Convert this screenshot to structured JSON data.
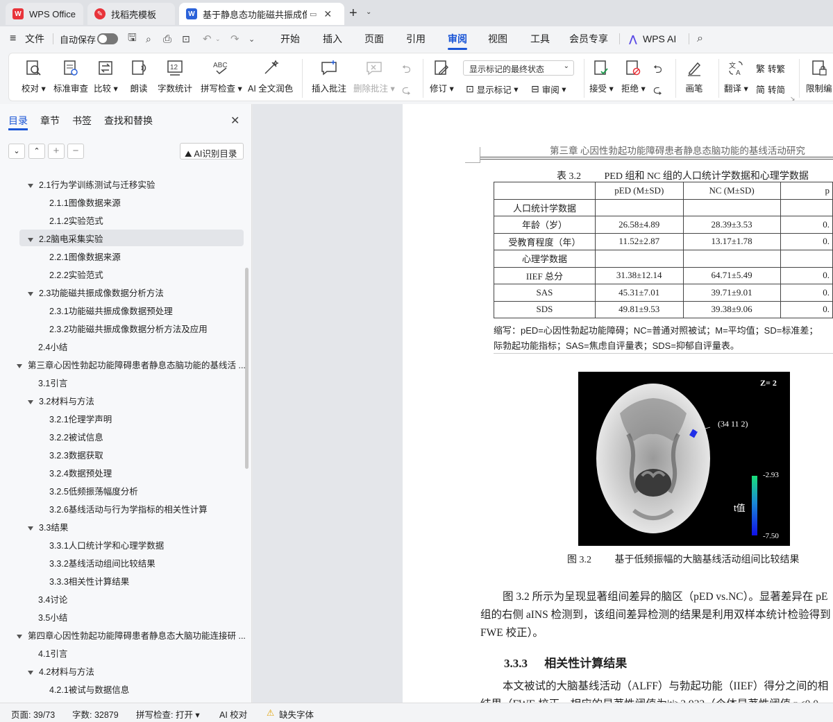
{
  "tabs": [
    {
      "label": "WPS Office"
    },
    {
      "label": "找稻壳模板"
    },
    {
      "label": "基于静息态功能磁共振成像的"
    }
  ],
  "menu": {
    "file": "文件",
    "autosave": "自动保存",
    "items": [
      "开始",
      "插入",
      "页面",
      "引用",
      "审阅",
      "视图",
      "工具",
      "会员专享"
    ],
    "active": "审阅",
    "wps_ai": "WPS AI"
  },
  "ribbon": {
    "proofread": "校对",
    "std_review": "标准审查",
    "compare": "比较",
    "read_aloud": "朗读",
    "word_count": "字数统计",
    "spell_check": "拼写检查",
    "ai_polish": "AI 全文润色",
    "insert_comment": "插入批注",
    "delete_comment": "删除批注",
    "track": "修订",
    "display_select": "显示标记的最终状态",
    "show_markup": "显示标记",
    "review": "审阅",
    "accept": "接受",
    "reject": "拒绝",
    "brush": "画笔",
    "translate": "翻译",
    "to_trad": "转繁",
    "to_simp": "转简",
    "restrict": "限制编"
  },
  "left_panel": {
    "tabs": [
      "目录",
      "章节",
      "书签",
      "查找和替换"
    ],
    "ai_toc": "AI识别目录",
    "toc": [
      {
        "text": "2.1行为学训练测试与迁移实验",
        "level": 2,
        "caret": true
      },
      {
        "text": "2.1.1图像数据来源",
        "level": 3
      },
      {
        "text": "2.1.2实验范式",
        "level": 3
      },
      {
        "text": "2.2脑电采集实验",
        "level": 2,
        "caret": true,
        "selected": true
      },
      {
        "text": "2.2.1图像数据来源",
        "level": 3
      },
      {
        "text": "2.2.2实验范式",
        "level": 3
      },
      {
        "text": "2.3功能磁共振成像数据分析方法",
        "level": 2,
        "caret": true
      },
      {
        "text": "2.3.1功能磁共振成像数据预处理",
        "level": 3
      },
      {
        "text": "2.3.2功能磁共振成像数据分析方法及应用",
        "level": 3
      },
      {
        "text": "2.4小结",
        "level": 2
      },
      {
        "text": "第三章心因性勃起功能障碍患者静息态脑功能的基线活 ...",
        "level": 1,
        "caret": true
      },
      {
        "text": "3.1引言",
        "level": 2
      },
      {
        "text": "3.2材料与方法",
        "level": 2,
        "caret": true
      },
      {
        "text": "3.2.1伦理学声明",
        "level": 3
      },
      {
        "text": "3.2.2被试信息",
        "level": 3
      },
      {
        "text": "3.2.3数据获取",
        "level": 3
      },
      {
        "text": "3.2.4数据预处理",
        "level": 3
      },
      {
        "text": "3.2.5低频振荡幅度分析",
        "level": 3
      },
      {
        "text": "3.2.6基线活动与行为学指标的相关性计算",
        "level": 3
      },
      {
        "text": "3.3结果",
        "level": 2,
        "caret": true
      },
      {
        "text": "3.3.1人口统计学和心理学数据",
        "level": 3
      },
      {
        "text": "3.3.2基线活动组间比较结果",
        "level": 3
      },
      {
        "text": "3.3.3相关性计算结果",
        "level": 3
      },
      {
        "text": "3.4讨论",
        "level": 2
      },
      {
        "text": "3.5小结",
        "level": 2
      },
      {
        "text": "第四章心因性勃起功能障碍患者静息态大脑功能连接研 ...",
        "level": 1,
        "caret": true
      },
      {
        "text": "4.1引言",
        "level": 2
      },
      {
        "text": "4.2材料与方法",
        "level": 2,
        "caret": true
      },
      {
        "text": "4.2.1被试与数据信息",
        "level": 3
      }
    ]
  },
  "doc": {
    "header": "第三章  心因性勃起功能障碍患者静息态脑功能的基线活动研究",
    "table_caption_num": "表 3.2",
    "table_caption": "PED 组和 NC 组的人口统计学数据和心理学数据",
    "table": {
      "headers": [
        "",
        "pED (M±SD)",
        "NC (M±SD)",
        "p"
      ],
      "rows": [
        [
          "人口统计学数据",
          "",
          "",
          ""
        ],
        [
          "年龄（岁）",
          "26.58±4.89",
          "28.39±3.53",
          "0."
        ],
        [
          "受教育程度（年）",
          "11.52±2.87",
          "13.17±1.78",
          "0."
        ],
        [
          "心理学数据",
          "",
          "",
          ""
        ],
        [
          "IIEF 总分",
          "31.38±12.14",
          "64.71±5.49",
          "0."
        ],
        [
          "SAS",
          "45.31±7.01",
          "39.71±9.01",
          "0."
        ],
        [
          "SDS",
          "49.81±9.53",
          "39.38±9.06",
          "0."
        ]
      ]
    },
    "note_line1": "缩写：pED=心因性勃起功能障碍；NC=普通对照被试；M=平均值；SD=标准差；",
    "note_line2": "际勃起功能指标；SAS=焦虑自评量表；SDS=抑郁自评量表。",
    "figure": {
      "z_label": "Z= 2",
      "coord": "(34 11 2)",
      "cb_max": "-2.93",
      "cb_min": "-7.50",
      "t_label": "t值"
    },
    "figure_caption_num": "图 3.2",
    "figure_caption": "基于低频振幅的大脑基线活动组间比较结果",
    "para1_line1": "图 3.2 所示为呈现显著组间差异的脑区（pED vs.NC）。显著差异在 pE",
    "para1_line2": "组的右侧 aINS 检测到，该组间差异检测的结果是利用双样本统计检验得到",
    "para1_line3": "FWE 校正）。",
    "section_num": "3.3.3",
    "section_title": "相关性计算结果",
    "para2_line1": "本文被试的大脑基线活动（ALFF）与勃起功能（IIEF）得分之间的相",
    "para2_line2": "结果（FWE 校正，相应的显著性阈值为|t|>2.932（个体显著性阈值 p<0.0"
  },
  "status": {
    "page": "页面: 39/73",
    "words": "字数: 32879",
    "spell": "拼写检查: 打开",
    "ai_check": "AI 校对",
    "missing_font": "缺失字体"
  },
  "colors": {
    "accent": "#1a55d6",
    "wps_red": "#e8333a"
  }
}
